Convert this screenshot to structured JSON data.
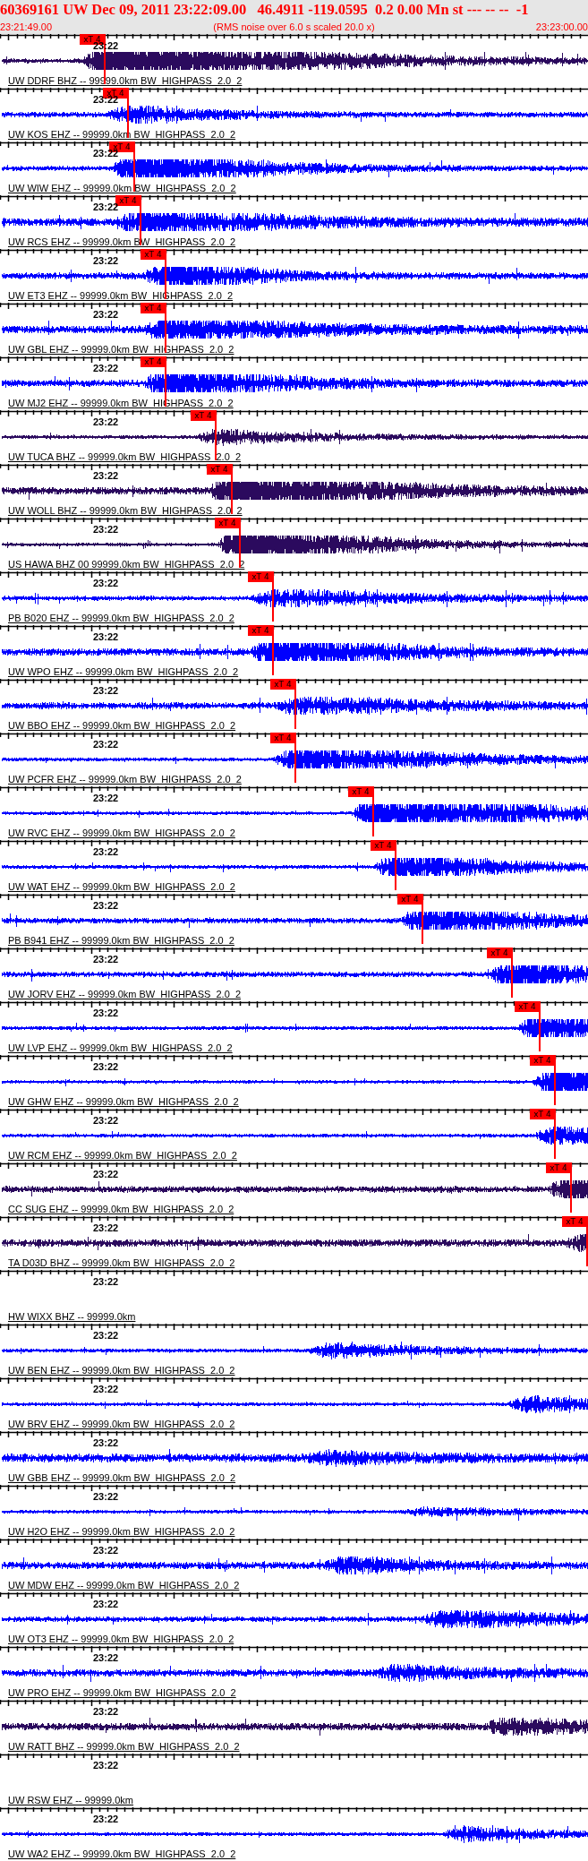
{
  "header": {
    "title": "60369161 UW Dec 09, 2011 23:22:09.00   46.4911 -119.0595  0.2 0.00 Mn st --- -- --  -1",
    "start_time": "23:21:49.00",
    "note": "(RMS noise over 6.0 s scaled 20.0 x)",
    "end_time": "23:23:00.00"
  },
  "panels": [
    {
      "station": "UW DDRF BHZ -- 99999.0km BW  HIGHPASS  2.0  2",
      "time_label": "23:22",
      "kind": "wave",
      "color": "#2b0a5e",
      "pick": {
        "label": "xT 4"
      }
    },
    {
      "station": "UW KOS EHZ -- 99999.0km BW  HIGHPASS  2.0  2",
      "time_label": "23:22",
      "kind": "wave",
      "color": "#0000ff",
      "pick": {
        "label": "xT 4"
      }
    },
    {
      "station": "UW WIW EHZ -- 99999.0km BW  HIGHPASS  2.0  2",
      "time_label": "23:22",
      "kind": "wave",
      "color": "#0000ff",
      "pick": {
        "label": "xT 4"
      }
    },
    {
      "station": "UW RCS EHZ -- 99999.0km BW  HIGHPASS  2.0  2",
      "time_label": "23:22",
      "kind": "wave",
      "color": "#0000ff",
      "pick": {
        "label": "xT 4"
      }
    },
    {
      "station": "UW ET3 EHZ -- 99999.0km BW  HIGHPASS  2.0  2",
      "time_label": "23:22",
      "kind": "wave",
      "color": "#0000ff",
      "pick": {
        "label": "xT 4"
      }
    },
    {
      "station": "UW GBL EHZ -- 99999.0km BW  HIGHPASS  2.0  2",
      "time_label": "23:22",
      "kind": "wave",
      "color": "#0000ff",
      "pick": {
        "label": "xT 4"
      }
    },
    {
      "station": "UW MJ2 EHZ -- 99999.0km BW  HIGHPASS  2.0  2",
      "time_label": "23:22",
      "kind": "wave",
      "color": "#0000ff",
      "pick": {
        "label": "xT 4"
      }
    },
    {
      "station": "UW TUCA BHZ -- 99999.0km BW  HIGHPASS  2.0  2",
      "time_label": "23:22",
      "kind": "wave",
      "color": "#2b0a5e",
      "pick": {
        "label": "xT 4"
      }
    },
    {
      "station": "UW WOLL BHZ -- 99999.0km BW  HIGHPASS  2.0  2",
      "time_label": "23:22",
      "kind": "wave",
      "color": "#2b0a5e",
      "pick": {
        "label": "xT 4"
      }
    },
    {
      "station": "US HAWA BHZ 00 99999.0km BW  HIGHPASS  2.0  2",
      "time_label": "23:22",
      "kind": "wave",
      "color": "#2b0a5e",
      "pick": {
        "label": "xT 4"
      }
    },
    {
      "station": "PB B020 EHZ -- 99999.0km BW  HIGHPASS  2.0  2",
      "time_label": "23:22",
      "kind": "wave",
      "color": "#0000ff",
      "pick": {
        "label": "xT 4"
      }
    },
    {
      "station": "UW WPO EHZ -- 99999.0km BW  HIGHPASS  2.0  2",
      "time_label": "23:22",
      "kind": "wave",
      "color": "#0000ff",
      "pick": {
        "label": "xT 4"
      }
    },
    {
      "station": "UW BBO EHZ -- 99999.0km BW  HIGHPASS  2.0  2",
      "time_label": "23:22",
      "kind": "wave",
      "color": "#0000ff",
      "pick": {
        "label": "xT 4"
      }
    },
    {
      "station": "UW PCFR EHZ -- 99999.0km BW  HIGHPASS  2.0  2",
      "time_label": "23:22",
      "kind": "wave",
      "color": "#0000ff",
      "pick": {
        "label": "xT 4"
      }
    },
    {
      "station": "UW RVC EHZ -- 99999.0km BW  HIGHPASS  2.0  2",
      "time_label": "23:22",
      "kind": "wave",
      "color": "#0000ff",
      "pick": {
        "label": "xT 4"
      }
    },
    {
      "station": "UW WAT EHZ -- 99999.0km BW  HIGHPASS  2.0  2",
      "time_label": "23:22",
      "kind": "wave",
      "color": "#0000ff",
      "pick": {
        "label": "xT 4"
      }
    },
    {
      "station": "PB B941 EHZ -- 99999.0km BW  HIGHPASS  2.0  2",
      "time_label": "23:22",
      "kind": "wave",
      "color": "#0000ff",
      "pick": {
        "label": "xT 4"
      }
    },
    {
      "station": "UW JORV EHZ -- 99999.0km BW  HIGHPASS  2.0  2",
      "time_label": "23:22",
      "kind": "wave",
      "color": "#0000ff",
      "pick": {
        "label": "xT 4"
      }
    },
    {
      "station": "UW LVP EHZ -- 99999.0km BW  HIGHPASS  2.0  2",
      "time_label": "23:22",
      "kind": "wave",
      "color": "#0000ff",
      "pick": {
        "label": "xT 4"
      }
    },
    {
      "station": "UW GHW EHZ -- 99999.0km BW  HIGHPASS  2.0  2",
      "time_label": "23:22",
      "kind": "wave",
      "color": "#0000ff",
      "pick": {
        "label": "xT 4"
      }
    },
    {
      "station": "UW RCM EHZ -- 99999.0km BW  HIGHPASS  2.0  2",
      "time_label": "23:22",
      "kind": "wave",
      "color": "#0000ff",
      "pick": {
        "label": "xT 4"
      }
    },
    {
      "station": "CC SUG EHZ -- 99999.0km BW  HIGHPASS  2.0  2",
      "time_label": "23:22",
      "kind": "wave",
      "color": "#2b0a5e",
      "pick": {
        "label": "xT 4"
      }
    },
    {
      "station": "TA D03D BHZ -- 99999.0km BW  HIGHPASS  2.0  2",
      "time_label": "23:22",
      "kind": "wave",
      "color": "#2b0a5e",
      "pick": {
        "label": "xT 4"
      }
    },
    {
      "station": "HW WIXX BHZ -- 99999.0km",
      "time_label": "23:22",
      "kind": "blank"
    },
    {
      "station": "UW BEN EHZ -- 99999.0km BW  HIGHPASS  2.0  2",
      "time_label": "23:22",
      "kind": "wave",
      "color": "#0000ff"
    },
    {
      "station": "UW BRV EHZ -- 99999.0km BW  HIGHPASS  2.0  2",
      "time_label": "23:22",
      "kind": "wave",
      "color": "#0000ff"
    },
    {
      "station": "UW GBB EHZ -- 99999.0km BW  HIGHPASS  2.0  2",
      "time_label": "23:22",
      "kind": "wave",
      "color": "#0000ff"
    },
    {
      "station": "UW H2O EHZ -- 99999.0km BW  HIGHPASS  2.0  2",
      "time_label": "23:22",
      "kind": "wave",
      "color": "#0000ff"
    },
    {
      "station": "UW MDW EHZ -- 99999.0km BW  HIGHPASS  2.0  2",
      "time_label": "23:22",
      "kind": "wave",
      "color": "#0000ff"
    },
    {
      "station": "UW OT3 EHZ -- 99999.0km BW  HIGHPASS  2.0  2",
      "time_label": "23:22",
      "kind": "wave",
      "color": "#0000ff"
    },
    {
      "station": "UW PRO EHZ -- 99999.0km BW  HIGHPASS  2.0  2",
      "time_label": "23:22",
      "kind": "wave",
      "color": "#0000ff"
    },
    {
      "station": "UW RATT BHZ -- 99999.0km BW  HIGHPASS  2.0  2",
      "time_label": "23:22",
      "kind": "wave",
      "color": "#2b0a5e"
    },
    {
      "station": "UW RSW EHZ -- 99999.0km",
      "time_label": "23:22",
      "kind": "blank"
    },
    {
      "station": "UW WA2 EHZ -- 99999.0km BW  HIGHPASS  2.0  2",
      "time_label": "23:22",
      "kind": "wave",
      "color": "#0000ff"
    }
  ]
}
